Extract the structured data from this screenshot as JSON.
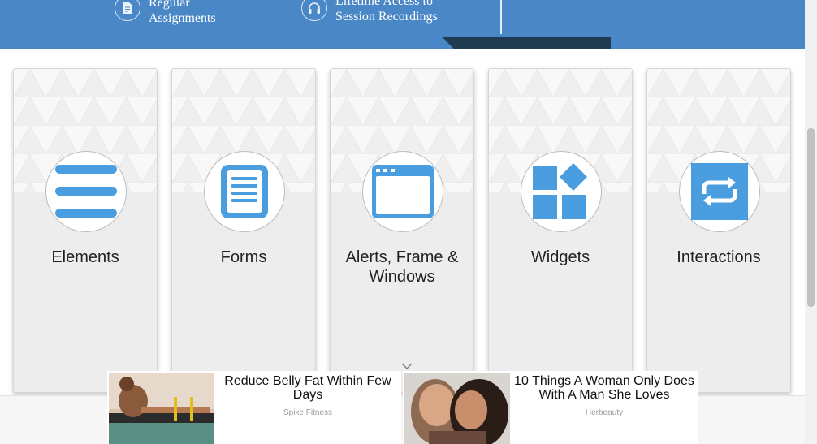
{
  "banner": {
    "items": [
      {
        "icon": "document-icon",
        "line1": "Regular",
        "line2": "Assignments"
      },
      {
        "icon": "headphones-icon",
        "line1": "Lifetime Access to",
        "line2": "Session Recordings"
      }
    ],
    "color": "#4a87c7"
  },
  "cards": [
    {
      "title": "Elements",
      "icon": "hamburger-menu-icon"
    },
    {
      "title": "Forms",
      "icon": "form-document-icon"
    },
    {
      "title": "Alerts, Frame & Windows",
      "icon": "browser-window-icon"
    },
    {
      "title": "Widgets",
      "icon": "widgets-grid-icon"
    },
    {
      "title": "Interactions",
      "icon": "repeat-arrows-icon"
    }
  ],
  "ads": [
    {
      "headline": "Reduce Belly Fat Within Few Days",
      "source": "Spike Fitness"
    },
    {
      "headline": "10 Things A Woman Only Does With A Man She Loves",
      "source": "Herbeauty"
    }
  ],
  "colors": {
    "accent": "#4a9ee0",
    "banner": "#4a87c7",
    "ribbon": "#203a51"
  }
}
